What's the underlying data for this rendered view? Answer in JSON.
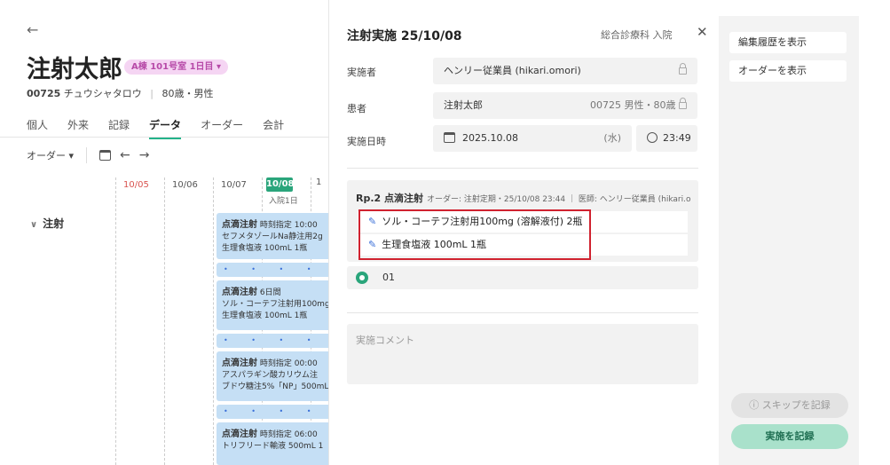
{
  "patient": {
    "back_arrow": "←",
    "name": "注射太郎",
    "badge": "A棟 101号室 1日目 ▾",
    "id": "00725",
    "kana": "チュウシャタロウ",
    "age_sex": "80歳・男性"
  },
  "tabs": [
    "個人",
    "外来",
    "記録",
    "データ",
    "オーダー",
    "会計"
  ],
  "toolbar": {
    "filter": "オーダー ▾",
    "prev": "←",
    "next": "→"
  },
  "timeline": {
    "dates": [
      "10/05",
      "10/06",
      "10/07"
    ],
    "today": "10/08",
    "today_sub": "入院1日",
    "next_partial": "1",
    "section": "注射",
    "blocks": [
      {
        "title": "点滴注射",
        "sub": "時刻指定 10:00",
        "lines": [
          "セフメタゾールNa静注用2g",
          "生理食塩液 100mL 1瓶"
        ]
      },
      {
        "title": "点滴注射",
        "sub": "6日間",
        "lines": [
          "ソル・コーテフ注射用100mg",
          "生理食塩液 100mL 1瓶"
        ]
      },
      {
        "title": "点滴注射",
        "sub": "時刻指定 00:00",
        "lines": [
          "アスパラギン酸カリウム注",
          "ブドウ糖注5%「NP」500mL"
        ]
      },
      {
        "title": "点滴注射",
        "sub": "時刻指定 06:00",
        "lines": [
          "トリフリード輸液 500mL 1"
        ]
      }
    ],
    "dots": "• • • • •"
  },
  "modal": {
    "title": "注射実施 25/10/08",
    "dept": "総合診療科 入院",
    "close": "✕",
    "performer_label": "実施者",
    "performer": "ヘンリー従業員 (hikari.omori)",
    "patient_label": "患者",
    "patient_name": "注射太郎",
    "patient_info": "00725 男性・80歳",
    "date_label": "実施日時",
    "date": "2025.10.08",
    "weekday": "(水)",
    "time": "23:49",
    "rp_title": "Rp.2 点滴注射",
    "rp_meta": "オーダー: 注射定期・25/10/08 23:44 ｜ 医師: ヘンリー従業員 (hikari.o",
    "drugs": [
      "ソル・コーテフ注射用100mg (溶解液付) 2瓶",
      "生理食塩液 100mL 1瓶"
    ],
    "lot": "01",
    "comment_placeholder": "実施コメント"
  },
  "side": {
    "history": "編集履歴を表示",
    "order": "オーダーを表示",
    "skip": "ⓘ スキップを記録",
    "record": "実施を記録"
  },
  "colors": {
    "accent": "#2aa57b",
    "highlight": "#d0222f",
    "block": "#c5dff5",
    "badge": "#f5d5f3"
  }
}
